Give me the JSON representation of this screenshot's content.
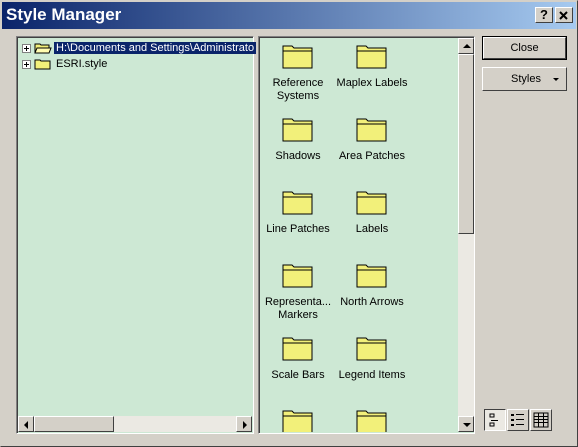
{
  "window": {
    "title": "Style Manager",
    "help_label": "?",
    "close_label": "✕"
  },
  "tree": {
    "items": [
      {
        "label": "H:\\Documents and Settings\\Administrato",
        "selected": true,
        "icon": "open-folder-icon"
      },
      {
        "label": "ESRI.style",
        "selected": false,
        "icon": "folder-icon"
      }
    ]
  },
  "content": {
    "items": [
      {
        "label": "Reference\nSystems"
      },
      {
        "label": "Maplex Labels"
      },
      {
        "label": "Shadows"
      },
      {
        "label": "Area Patches"
      },
      {
        "label": "Line Patches"
      },
      {
        "label": "Labels"
      },
      {
        "label": "Representa...\nMarkers"
      },
      {
        "label": "North Arrows"
      },
      {
        "label": "Scale Bars"
      },
      {
        "label": "Legend Items"
      },
      {
        "label": ""
      },
      {
        "label": ""
      }
    ]
  },
  "buttons": {
    "close_label": "Close",
    "styles_label": "Styles"
  },
  "views": {
    "icons": "large-icons-view-icon",
    "list": "list-view-icon",
    "details": "details-view-icon",
    "active": "large-icons"
  },
  "colors": {
    "title_start": "#0a246a",
    "title_end": "#a6caf0",
    "panel_bg": "#cde8d4",
    "folder_yellow": "#f2f07a"
  }
}
